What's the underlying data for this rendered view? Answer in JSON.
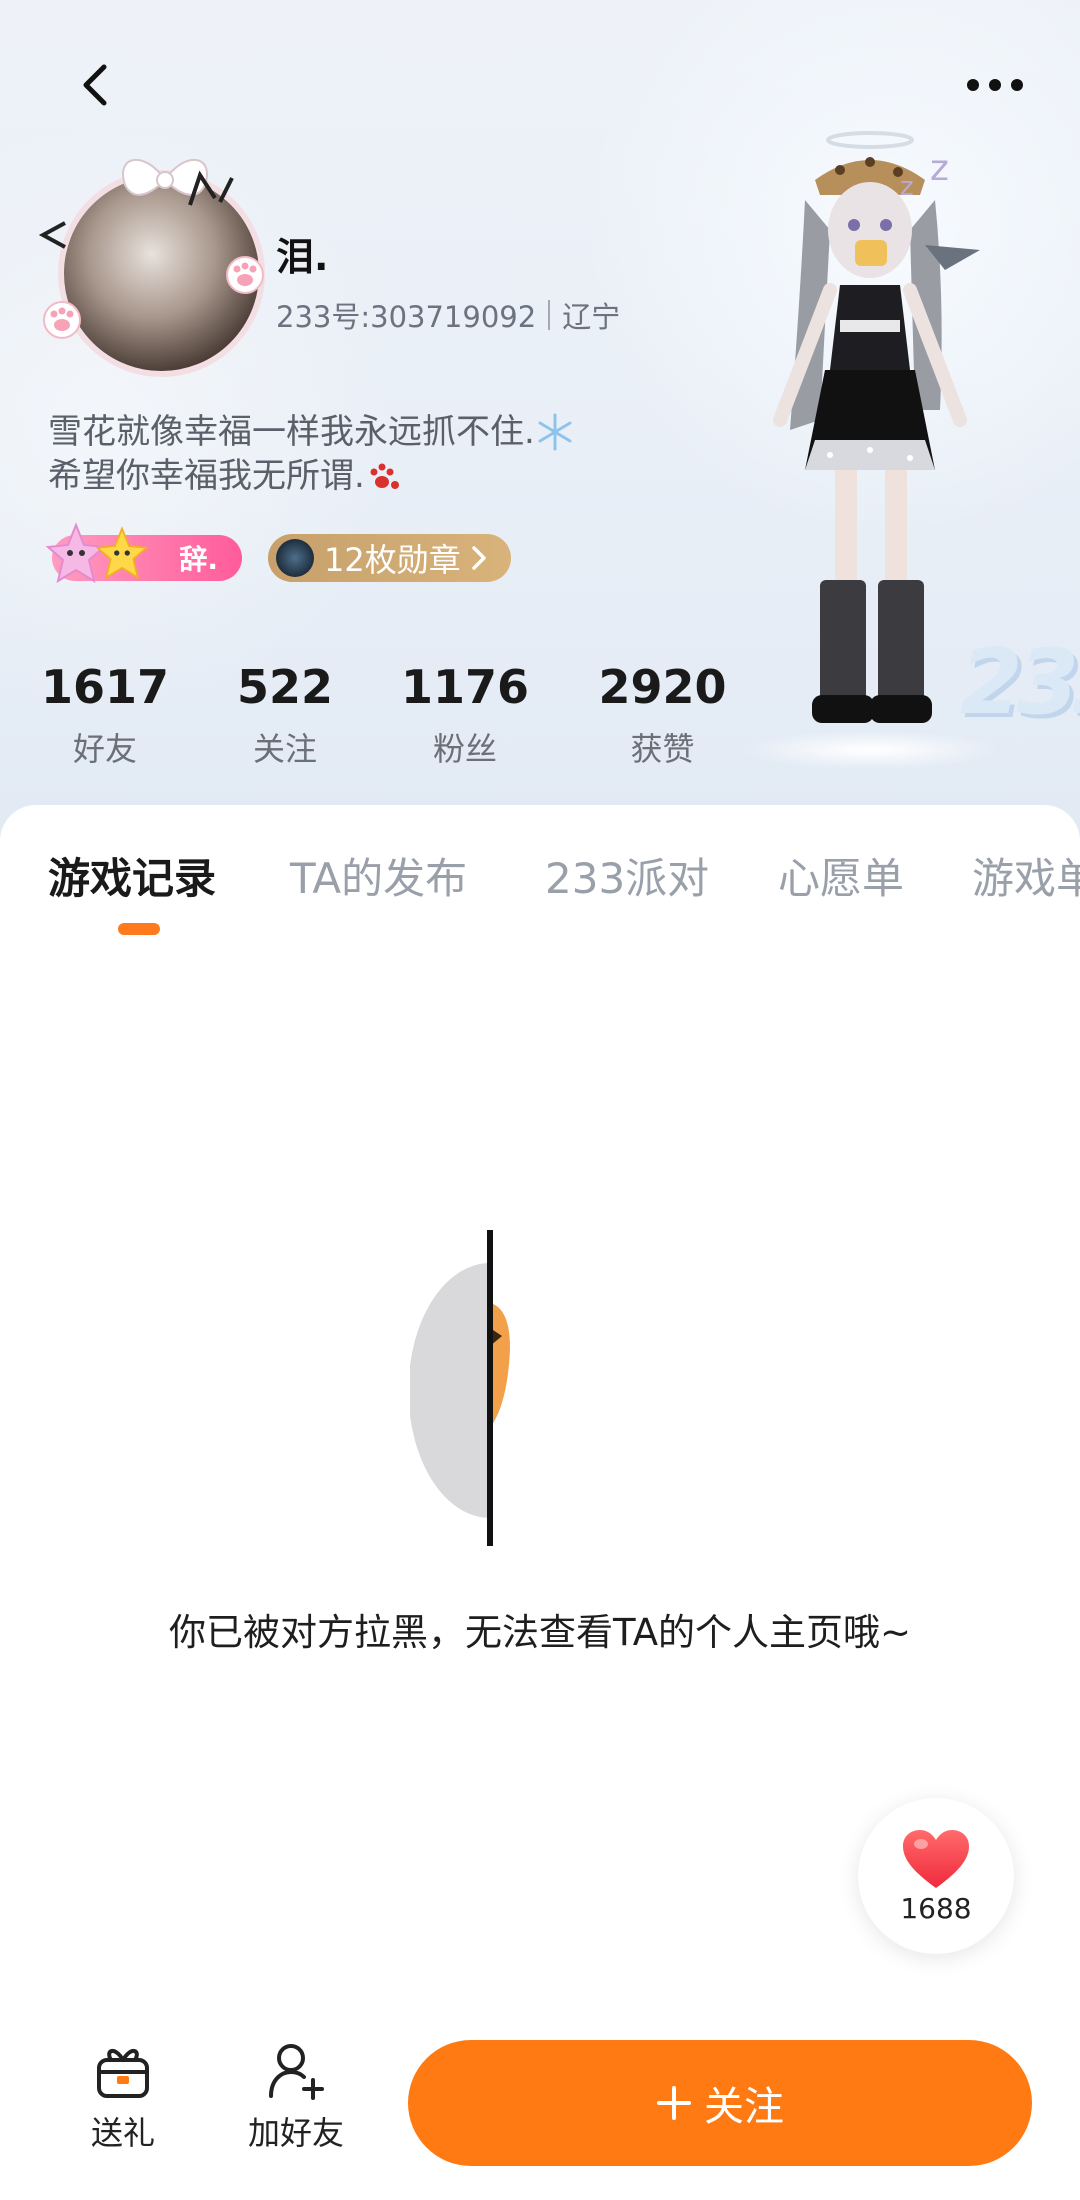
{
  "nav": {
    "back_icon": "chevron-left-icon",
    "more_icon": "more-horizontal-icon"
  },
  "profile": {
    "name": "泪.",
    "id_text": "233号:303719092",
    "location": "辽宁",
    "bio_line1": "雪花就像幸福一样我永远抓不住.",
    "bio_line2": "希望你幸福我无所谓.",
    "name_tag": "辞.",
    "medal_label": "12枚勋章"
  },
  "stats": [
    {
      "value": "1617",
      "label": "好友"
    },
    {
      "value": "522",
      "label": "关注"
    },
    {
      "value": "1176",
      "label": "粉丝"
    },
    {
      "value": "2920",
      "label": "获赞"
    }
  ],
  "tabs": [
    {
      "label": "游戏记录",
      "active": true
    },
    {
      "label": "TA的发布",
      "active": false
    },
    {
      "label": "233派对",
      "active": false
    },
    {
      "label": "心愿单",
      "active": false
    },
    {
      "label": "游戏单",
      "active": false
    }
  ],
  "blocked_message": "你已被对方拉黑，无法查看TA的个人主页哦~",
  "like": {
    "count": "1688",
    "icon": "heart-icon"
  },
  "bottom": {
    "gift_label": "送礼",
    "add_friend_label": "加好友",
    "follow_label": "关注"
  },
  "colors": {
    "accent": "#ff7a12",
    "tab_indicator": "#ff7a1c",
    "name_tag": "#ff5c9a",
    "medal": "#c7a06b"
  }
}
